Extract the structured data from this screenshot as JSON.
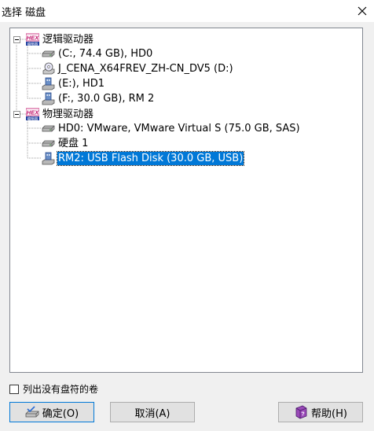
{
  "window": {
    "title": "选择 磁盘"
  },
  "tree": {
    "groups": [
      {
        "label": "逻辑驱动器",
        "items": [
          {
            "label": "(C:, 74.4 GB), HD0",
            "icon": "hard-disk-icon"
          },
          {
            "label": "J_CENA_X64FREV_ZH-CN_DV5 (D:)",
            "icon": "cd-drive-icon"
          },
          {
            "label": "(E:), HD1",
            "icon": "usb-drive-icon"
          },
          {
            "label": "(F:, 30.0 GB), RM 2",
            "icon": "usb-drive-icon"
          }
        ]
      },
      {
        "label": "物理驱动器",
        "items": [
          {
            "label": "HD0: VMware, VMware Virtual S (75.0 GB, SAS)",
            "icon": "hard-disk-icon"
          },
          {
            "label": "硬盘 1",
            "icon": "hard-disk-icon"
          },
          {
            "label": "RM2: USB Flash Disk (30.0 GB, USB)",
            "icon": "usb-drive-icon",
            "selected": true
          }
        ]
      }
    ]
  },
  "options": {
    "show_volumes_without_letter": "列出没有盘符的卷"
  },
  "buttons": {
    "ok": "确定(O)",
    "cancel": "取消(A)",
    "help": "帮助(H)"
  },
  "colors": {
    "selection": "#0078d7",
    "hex_badge": "#c0106a"
  }
}
